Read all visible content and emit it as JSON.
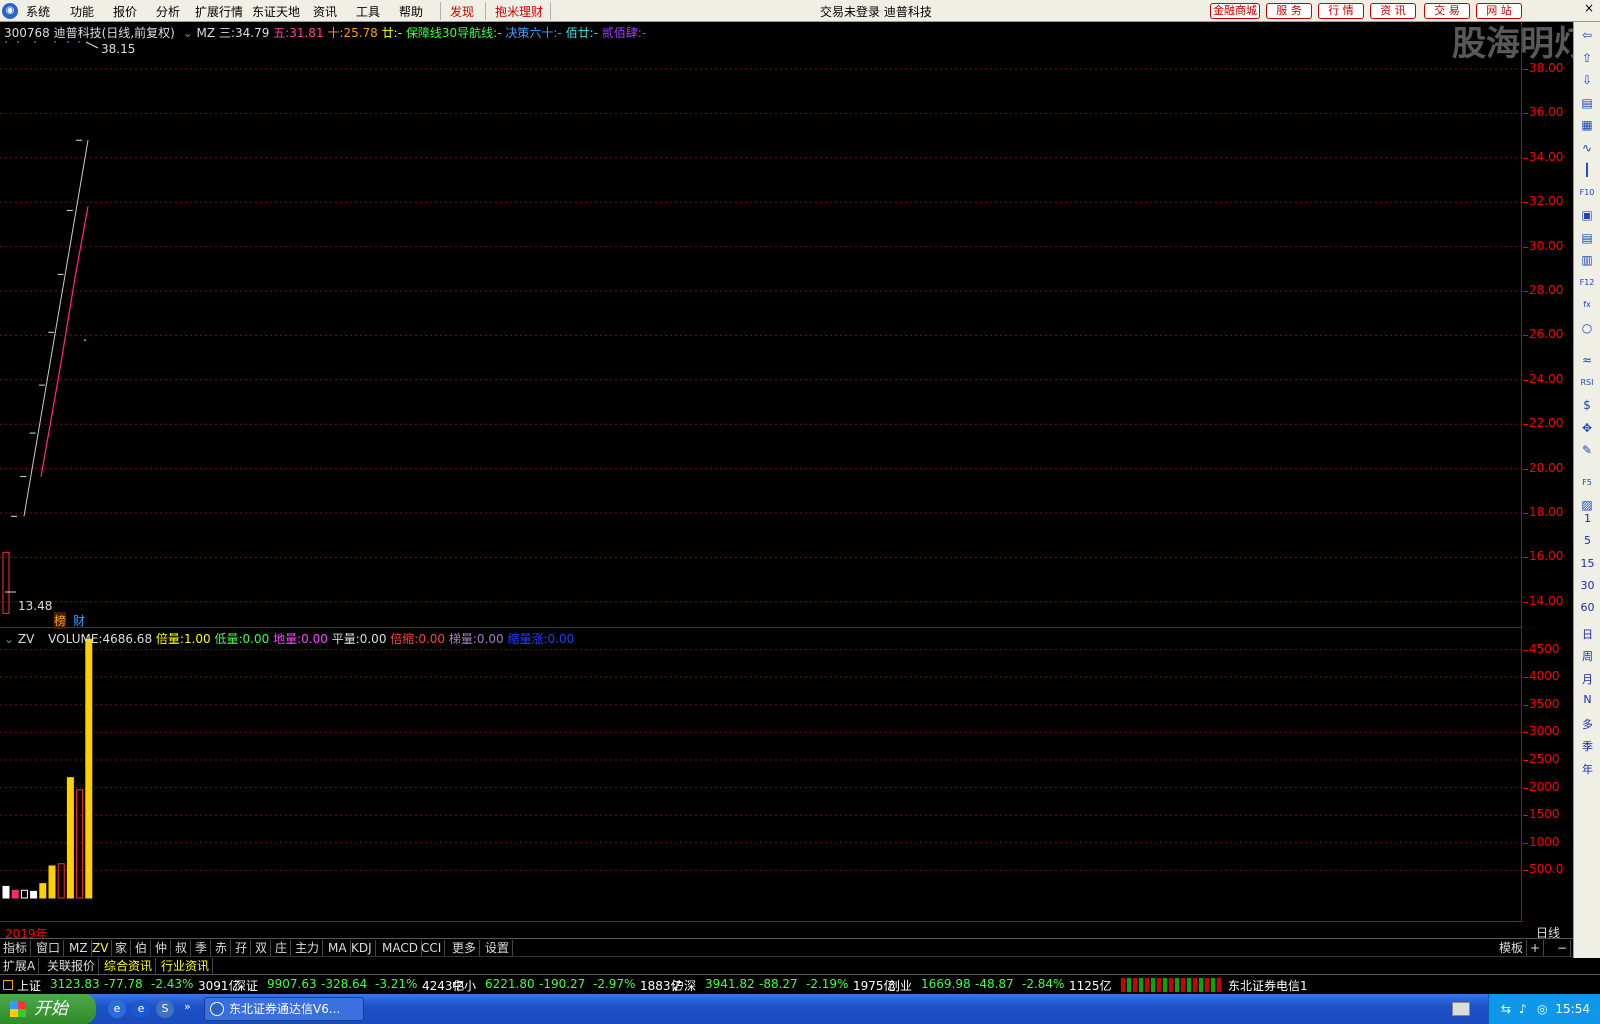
{
  "menu": {
    "items": [
      "系统",
      "功能",
      "报价",
      "分析",
      "扩展行情",
      "东证天地",
      "资讯",
      "工具",
      "帮助"
    ],
    "red_items": [
      "发现",
      "抱米理财"
    ],
    "window_title": "交易未登录  迪普科技",
    "right_buttons": [
      "金融商城",
      "服 务",
      "行 情",
      "资 讯",
      "交 易",
      "网 站"
    ]
  },
  "watermark": "股海明灯",
  "price_panel": {
    "stock": "300768 迪普科技(日线,前复权)",
    "indicator": "MZ",
    "ma3_label": "三:",
    "ma3": "34.79",
    "ma5_label": "五:",
    "ma5": "31.81",
    "ma10_label": "十:",
    "ma10": "25.78",
    "ma20_label": "廿:",
    "ma20": "-",
    "baozhang_label": "保障线30导航线:",
    "baozhang": "-",
    "juece_label": "决策六十:",
    "juece": "-",
    "bainian_label": "佰廿:",
    "bainian": "-",
    "erbai_label": "贰佰肆:",
    "erbai": "-",
    "high_mark": "38.15",
    "low_mark": "13.48",
    "badges": [
      "榜",
      "财"
    ],
    "y_ticks": [
      "38.00",
      "36.00",
      "34.00",
      "32.00",
      "30.00",
      "28.00",
      "26.00",
      "24.00",
      "22.00",
      "20.00",
      "18.00",
      "16.00",
      "14.00"
    ]
  },
  "vol_panel": {
    "indicator": "ZV",
    "volume_label": "VOLUME:",
    "volume": "4686.68",
    "beiliang_label": "倍量:",
    "beiliang": "1.00",
    "diliang_label": "低量:",
    "diliang": "0.00",
    "diliang2_label": "地量:",
    "diliang2": "0.00",
    "pingliang_label": "平量:",
    "pingliang": "0.00",
    "beisuo_label": "倍缩:",
    "beisuo": "0.00",
    "tiliang_label": "梯量:",
    "tiliang": "0.00",
    "suoliang_label": "缩量涨:",
    "suoliang": "0.00",
    "y_ticks": [
      "4500",
      "4000",
      "3500",
      "3000",
      "2500",
      "2000",
      "1500",
      "1000",
      "500.0"
    ],
    "year": "2019年",
    "period": "日线"
  },
  "chart_data": [
    {
      "type": "candlestick",
      "y_range": [
        13.48,
        38.15
      ],
      "closes": [
        17.85,
        19.64,
        21.6,
        23.76,
        26.14,
        28.75,
        31.63,
        34.79
      ],
      "open_first": 16.23,
      "low_first": 13.48,
      "ma3": [
        null,
        null,
        19.7,
        21.67,
        23.83,
        26.22,
        28.84,
        31.72,
        34.79
      ],
      "vol_dot_y": 25.78
    },
    {
      "type": "bar",
      "values": [
        210,
        140,
        140,
        120,
        260,
        580,
        620,
        2180,
        1960,
        4686.68
      ],
      "hollow": [
        false,
        false,
        true,
        false,
        false,
        false,
        true,
        false,
        true,
        false
      ],
      "y_range": [
        0,
        4800
      ]
    }
  ],
  "tabs": [
    "指标",
    "窗口",
    "MZ",
    "ZV",
    "家",
    "伯",
    "仲",
    "叔",
    "季",
    "赤",
    "孖",
    "双",
    "庄",
    "主力",
    "MA",
    "KDJ",
    "MACD",
    "CCI",
    "更多",
    "设置"
  ],
  "tabs_active": "ZV",
  "tabs_right": [
    "模板",
    "+",
    "−"
  ],
  "subtabs": [
    "扩展A",
    "关联报价",
    "综合资讯",
    "行业资讯"
  ],
  "right_tools_numbers": [
    "1",
    "5",
    "15",
    "30",
    "60",
    "日",
    "周",
    "月",
    "N",
    "多",
    "季",
    "年"
  ],
  "ticker": [
    {
      "name": "上证",
      "price": "3123.83",
      "chg": "-77.78",
      "pct": "-2.43%",
      "amt": "3091亿"
    },
    {
      "name": "深证",
      "price": "9907.63",
      "chg": "-328.64",
      "pct": "-3.21%",
      "amt": "4243亿"
    },
    {
      "name": "中小",
      "price": "6221.80",
      "chg": "-190.27",
      "pct": "-2.97%",
      "amt": "1883亿"
    },
    {
      "name": "沪深",
      "price": "3941.82",
      "chg": "-88.27",
      "pct": "-2.19%",
      "amt": "1975亿"
    },
    {
      "name": "创业",
      "price": "1669.98",
      "chg": "-48.87",
      "pct": "-2.84%",
      "amt": "1125亿"
    }
  ],
  "broker": "东北证券电信1",
  "taskbar": {
    "start": "开始",
    "app": "东北证券通达信V6...",
    "clock": "15:54"
  }
}
